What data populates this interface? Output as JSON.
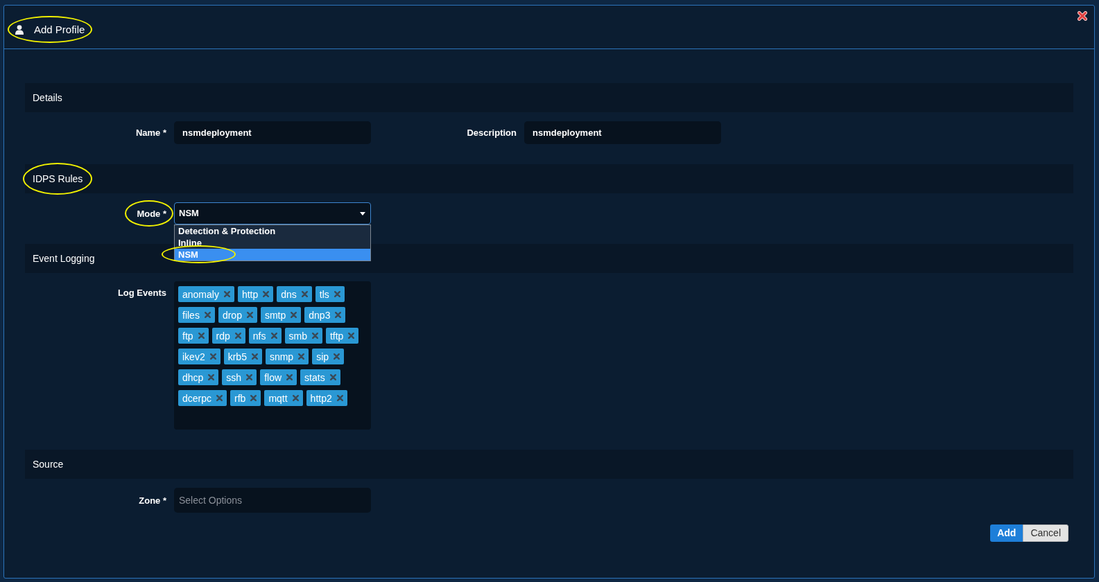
{
  "dialog": {
    "title": {
      "text": "Add Profile",
      "circled": true
    },
    "sections": [
      {
        "title": "Details",
        "circled": false,
        "fields": [
          {
            "kind": "text",
            "label": "Name *",
            "circled": false,
            "value": "nsmdeployment"
          },
          {
            "kind": "text",
            "label": "Description",
            "circled": false,
            "value": "nsmdeployment"
          }
        ]
      },
      {
        "title": "IDPS Rules",
        "circled": true,
        "fields": [
          {
            "kind": "select",
            "label": "Mode *",
            "circled": true,
            "value": "NSM",
            "expanded": true,
            "options": [
              {
                "label": "Detection & Protection",
                "selected": false,
                "circled": false
              },
              {
                "label": "Inline",
                "selected": false,
                "circled": false
              },
              {
                "label": "NSM",
                "selected": true,
                "circled": true
              }
            ]
          }
        ]
      },
      {
        "title": "Event Logging",
        "circled": false,
        "fields": [
          {
            "kind": "tags",
            "label": "Log Events",
            "circled": false,
            "tags": [
              "anomaly",
              "http",
              "dns",
              "tls",
              "files",
              "drop",
              "smtp",
              "dnp3",
              "ftp",
              "rdp",
              "nfs",
              "smb",
              "tftp",
              "ikev2",
              "krb5",
              "snmp",
              "sip",
              "dhcp",
              "ssh",
              "flow",
              "stats",
              "dcerpc",
              "rfb",
              "mqtt",
              "http2"
            ]
          }
        ]
      },
      {
        "title": "Source",
        "circled": false,
        "fields": [
          {
            "kind": "multiselect",
            "label": "Zone *",
            "circled": false,
            "placeholder": "Select Options"
          }
        ]
      }
    ],
    "buttons": [
      {
        "kind": "primary",
        "label": "Add"
      },
      {
        "kind": "secondary",
        "label": "Cancel"
      }
    ]
  }
}
